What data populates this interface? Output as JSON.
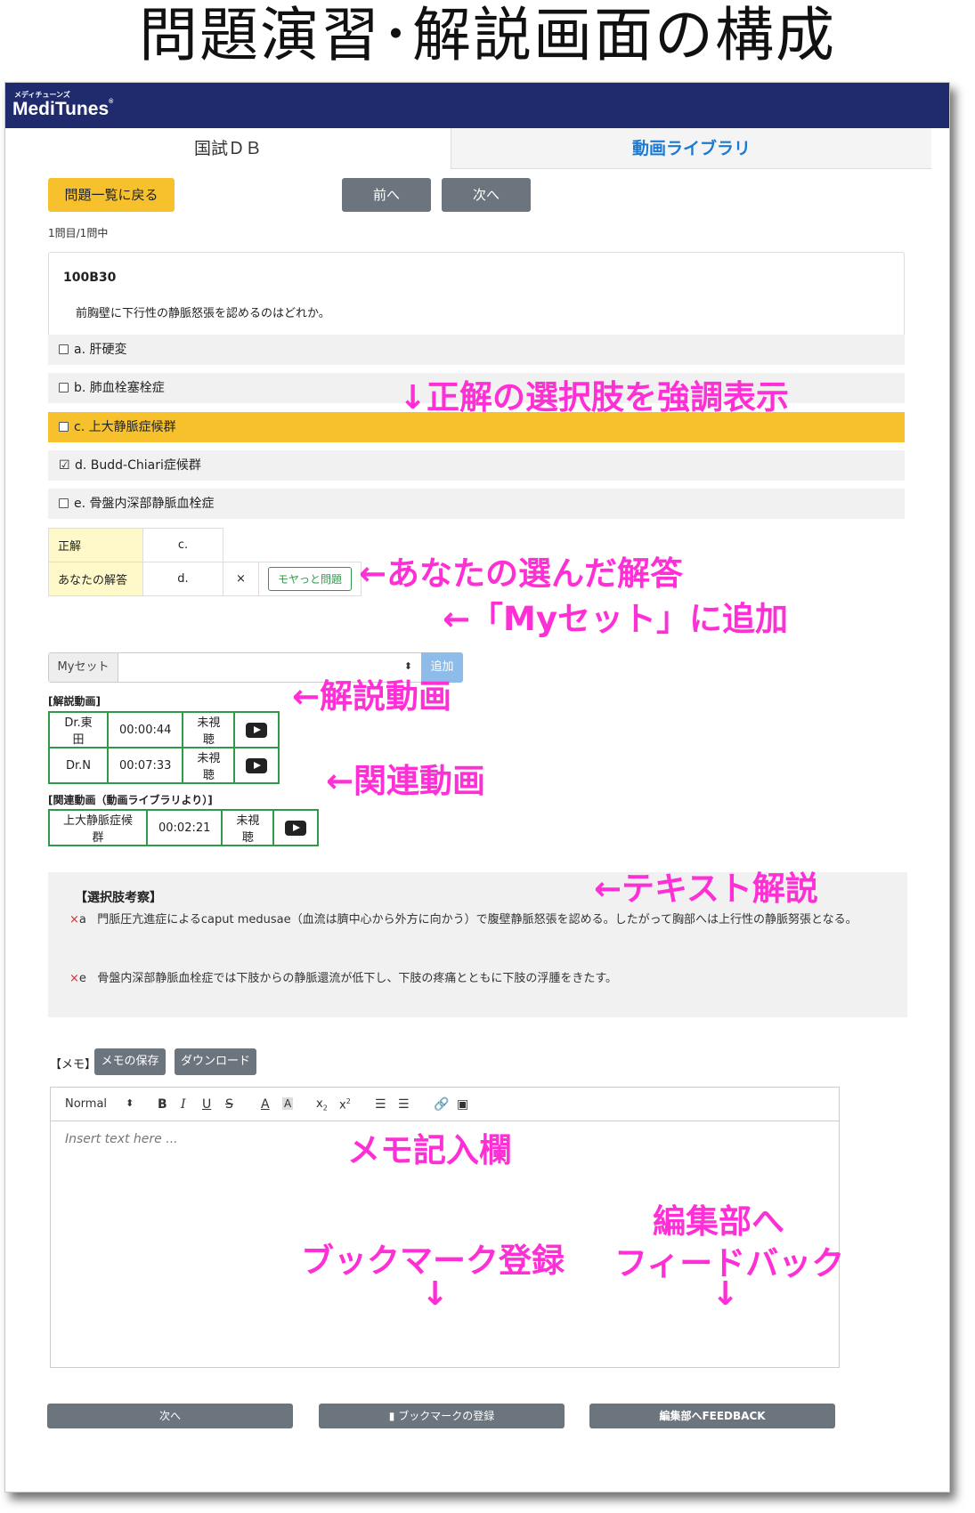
{
  "page_title": "問題演習･解説画面の構成",
  "brand": {
    "kana": "メディチューンズ",
    "name": "MediTunes",
    "reg": "®"
  },
  "tabs": [
    {
      "label": "国試ＤＢ"
    },
    {
      "label": "動画ライブラリ"
    }
  ],
  "nav": {
    "back": "問題一覧に戻る",
    "prev": "前へ",
    "next": "次へ"
  },
  "counter": "1問目/1問中",
  "question": {
    "id": "100B30",
    "text": "前胸壁に下行性の静脈怒張を認めるのはどれか。"
  },
  "choices": [
    {
      "label": "a. 肝硬変",
      "checked": false,
      "correct": false
    },
    {
      "label": "b. 肺血栓塞栓症",
      "checked": false,
      "correct": false
    },
    {
      "label": "c. 上大静脈症候群",
      "checked": false,
      "correct": true
    },
    {
      "label": "d. Budd-Chiari症候群",
      "checked": true,
      "correct": false
    },
    {
      "label": "e. 骨盤内深部静脈血栓症",
      "checked": false,
      "correct": false
    }
  ],
  "answer": {
    "correct_label": "正解",
    "correct_value": "c.",
    "yours_label": "あなたの解答",
    "yours_value": "d.",
    "mark": "×",
    "moya_button": "モヤっと問題"
  },
  "myset": {
    "label": "Myセット",
    "value": "",
    "add_button": "追加"
  },
  "explain_videos": {
    "heading": "[解説動画]",
    "rows": [
      {
        "doctor": "Dr.東田",
        "time": "00:00:44",
        "status": "未視聴"
      },
      {
        "doctor": "Dr.N",
        "time": "00:07:33",
        "status": "未視聴"
      }
    ]
  },
  "related_videos": {
    "heading": "[関連動画（動画ライブラリより）]",
    "rows": [
      {
        "title": "上大静脈症候群",
        "time": "00:02:21",
        "status": "未視聴"
      }
    ]
  },
  "explanation": {
    "title": "【選択肢考察】",
    "items": [
      {
        "mark": "×",
        "letter": "a",
        "text": "門脈圧亢進症によるcaput medusae（血流は臍中心から外方に向かう）で腹壁静脈怒張を認める。したがって胸部へは上行性の静脈努張となる。"
      },
      {
        "mark": "×",
        "letter": "e",
        "text": "骨盤内深部静脈血栓症では下肢からの静脈還流が低下し、下肢の疼痛とともに下肢の浮腫をきたす。"
      }
    ]
  },
  "memo": {
    "label": "【メモ】",
    "save_button": "メモの保存",
    "download_button": "ダウンロード",
    "format": "Normal",
    "placeholder": "Insert text here ..."
  },
  "bottom_buttons": {
    "next": "次へ",
    "bookmark": "ブックマークの登録",
    "feedback": "編集部へFEEDBACK"
  },
  "annotations": {
    "correct_highlight": "↓正解の選択肢を強調表示",
    "your_answer": "←あなたの選んだ解答",
    "myset_add": "←「Myセット」に追加",
    "explain_video": "←解説動画",
    "related_video": "←関連動画",
    "text_explain": "←テキスト解説",
    "memo_area": "メモ記入欄",
    "bookmark": "ブックマーク登録",
    "bookmark_arrow": "↓",
    "feedback_line1": "編集部へ",
    "feedback_line2": "フィードバック",
    "feedback_arrow": "↓"
  },
  "colors": {
    "brand_bar": "#1f2b6c",
    "correct_highlight": "#f6c12d",
    "annotation": "#ff2fd6",
    "video_border": "#2e9a4a"
  }
}
